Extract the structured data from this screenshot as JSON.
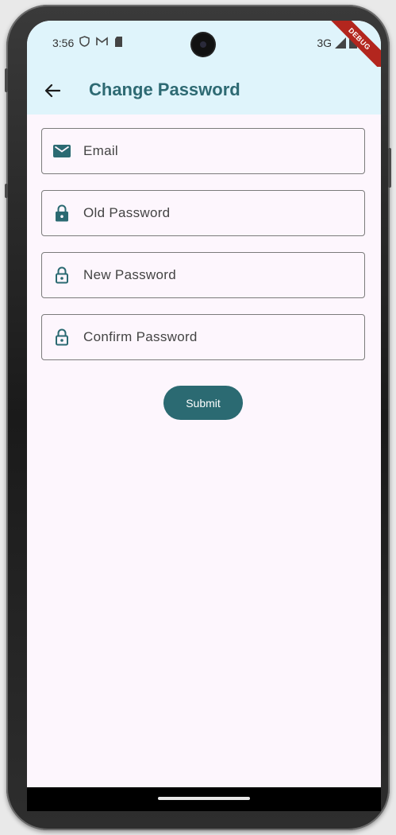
{
  "status_bar": {
    "time": "3:56",
    "network": "3G",
    "debug_banner": "DEBUG"
  },
  "app_bar": {
    "title": "Change Password",
    "back_icon": "arrow-back-icon"
  },
  "form": {
    "email": {
      "placeholder": "Email",
      "icon": "mail-icon"
    },
    "old_password": {
      "placeholder": "Old Password",
      "icon": "lock-filled-icon"
    },
    "new_password": {
      "placeholder": "New Password",
      "icon": "lock-outline-icon"
    },
    "confirm_password": {
      "placeholder": "Confirm Password",
      "icon": "lock-outline-icon"
    },
    "submit_label": "Submit"
  },
  "colors": {
    "primary": "#2b6a72",
    "app_bar_bg": "#dff4fb",
    "page_bg": "#fdf6fd"
  }
}
